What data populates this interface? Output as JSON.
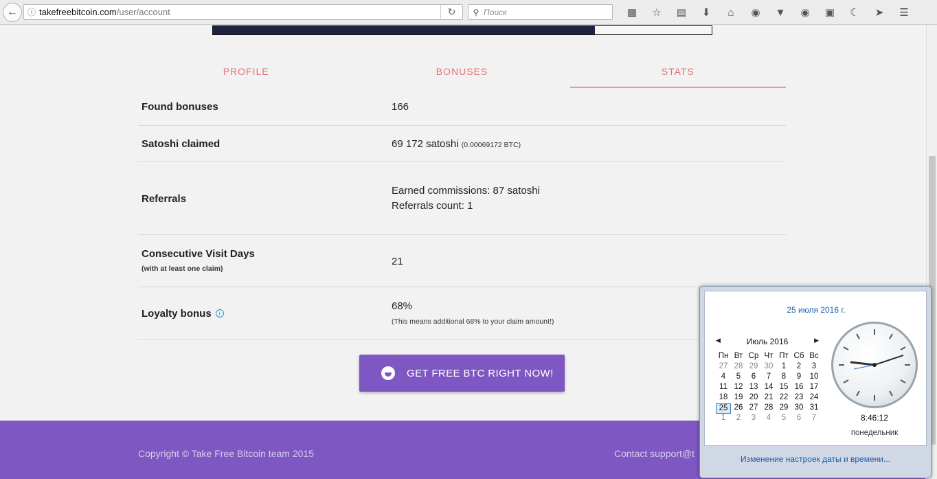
{
  "browser": {
    "host": "takefreebitcoin.com",
    "path": "/user/account",
    "search_placeholder": "Поиск"
  },
  "tabs": [
    {
      "label": "PROFILE"
    },
    {
      "label": "BONUSES"
    },
    {
      "label": "STATS"
    }
  ],
  "stats": {
    "found_bonuses": {
      "label": "Found bonuses",
      "value": "166"
    },
    "satoshi_claimed": {
      "label": "Satoshi claimed",
      "value": "69 172 satoshi",
      "btc": "(0.00069172 BTC)"
    },
    "referrals": {
      "label": "Referrals",
      "commissions": "Earned commissions: 87 satoshi",
      "count": "Referrals count: 1"
    },
    "visit_days": {
      "label": "Consecutive Visit Days",
      "note": "(with at least one claim)",
      "value": "21"
    },
    "loyalty": {
      "label": "Loyalty bonus",
      "value": "68%",
      "note": "(This means additional 68% to your claim amount!)"
    }
  },
  "cta": {
    "label": "GET FREE BTC RIGHT NOW!"
  },
  "footer": {
    "copyright": "Copyright © Take Free Bitcoin team 2015",
    "contact": "Contact support@t"
  },
  "clock": {
    "full_date": "25 июля 2016 г.",
    "month_label": "Июль 2016",
    "weekdays": [
      "Пн",
      "Вт",
      "Ср",
      "Чт",
      "Пт",
      "Сб",
      "Вс"
    ],
    "weeks": [
      [
        "27",
        "28",
        "29",
        "30",
        "1",
        "2",
        "3"
      ],
      [
        "4",
        "5",
        "6",
        "7",
        "8",
        "9",
        "10"
      ],
      [
        "11",
        "12",
        "13",
        "14",
        "15",
        "16",
        "17"
      ],
      [
        "18",
        "19",
        "20",
        "21",
        "22",
        "23",
        "24"
      ],
      [
        "25",
        "26",
        "27",
        "28",
        "29",
        "30",
        "31"
      ],
      [
        "1",
        "2",
        "3",
        "4",
        "5",
        "6",
        "7"
      ]
    ],
    "today": "25",
    "time": "8:46:12",
    "weekday": "понедельник",
    "change_link": "Изменение настроек даты и времени..."
  }
}
